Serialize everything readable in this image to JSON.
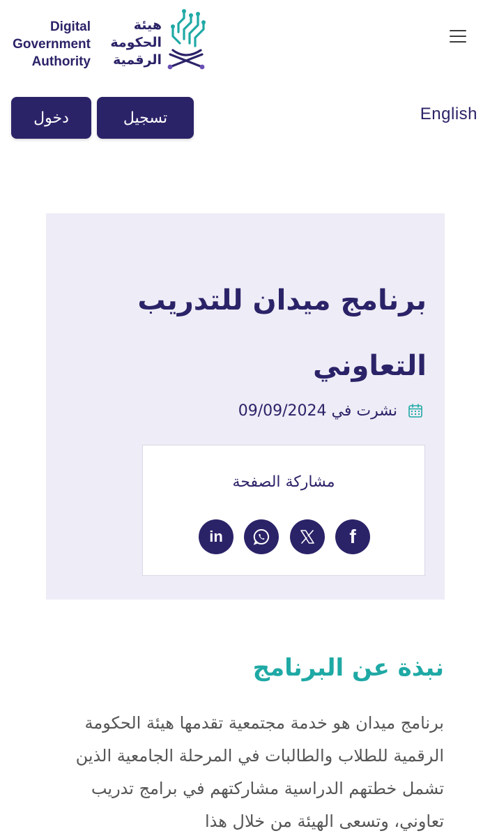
{
  "header": {
    "logo": {
      "name_en": "Digital Government Authority",
      "name_en_lines": [
        "Digital",
        "Government",
        "Authority"
      ],
      "name_ar": "هيئة الحكومة الرقمية",
      "name_ar_lines": [
        "هيئة",
        "الحكومة",
        "الرقمية"
      ],
      "colors": {
        "navy": "#2b2368",
        "teal": "#1fa9a5",
        "purple": "#6a4fb3"
      }
    },
    "menu_icon": "hamburger-icon",
    "login_label": "دخول",
    "register_label": "تسجيل",
    "language_label": "English"
  },
  "article": {
    "title": "برنامج ميدان للتدريب التعاوني",
    "published_label": "نشرت في",
    "published_date": "09/09/2024",
    "calendar_icon": "calendar-icon",
    "share": {
      "title": "مشاركة الصفحة",
      "buttons": [
        {
          "name": "linkedin",
          "glyph": "in"
        },
        {
          "name": "whatsapp",
          "glyph": ""
        },
        {
          "name": "x",
          "glyph": ""
        },
        {
          "name": "facebook",
          "glyph": "f"
        }
      ]
    }
  },
  "about": {
    "title": "نبذة عن البرنامج",
    "body": "برنامج ميدان هو خدمة مجتمعية تقدمها هيئة الحكومة الرقمية للطلاب والطالبات في المرحلة الجامعية الذين تشمل خطتهم الدراسية مشاركتهم في برامج تدريب تعاوني، وتسعى الهيئة من خلال هذا"
  },
  "colors": {
    "primary": "#2b2368",
    "accent": "#1fa9a5",
    "card_bg": "#eeecf6",
    "body_text": "#555555"
  }
}
